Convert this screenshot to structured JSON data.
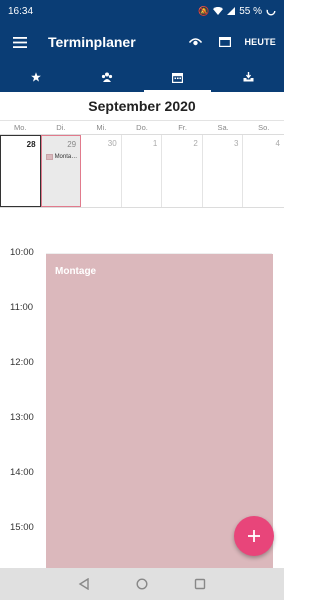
{
  "status_bar": {
    "time": "16:34",
    "battery": "55 %"
  },
  "app_bar": {
    "title": "Terminplaner",
    "today_label": "HEUTE"
  },
  "month_header": {
    "title": "September 2020"
  },
  "weekdays": [
    "Mo.",
    "Di.",
    "Mi.",
    "Do.",
    "Fr.",
    "Sa.",
    "So."
  ],
  "days": [
    {
      "num": "28"
    },
    {
      "num": "29"
    },
    {
      "num": "30"
    },
    {
      "num": "1"
    },
    {
      "num": "2"
    },
    {
      "num": "3"
    },
    {
      "num": "4"
    }
  ],
  "month_event_chip": {
    "label": "Monta…"
  },
  "hours": [
    "10:00",
    "11:00",
    "12:00",
    "13:00",
    "14:00",
    "15:00"
  ],
  "event": {
    "title": "Montage",
    "color": "#dbb8bc"
  },
  "colors": {
    "primary": "#0a3d75",
    "accent": "#e8457a"
  }
}
